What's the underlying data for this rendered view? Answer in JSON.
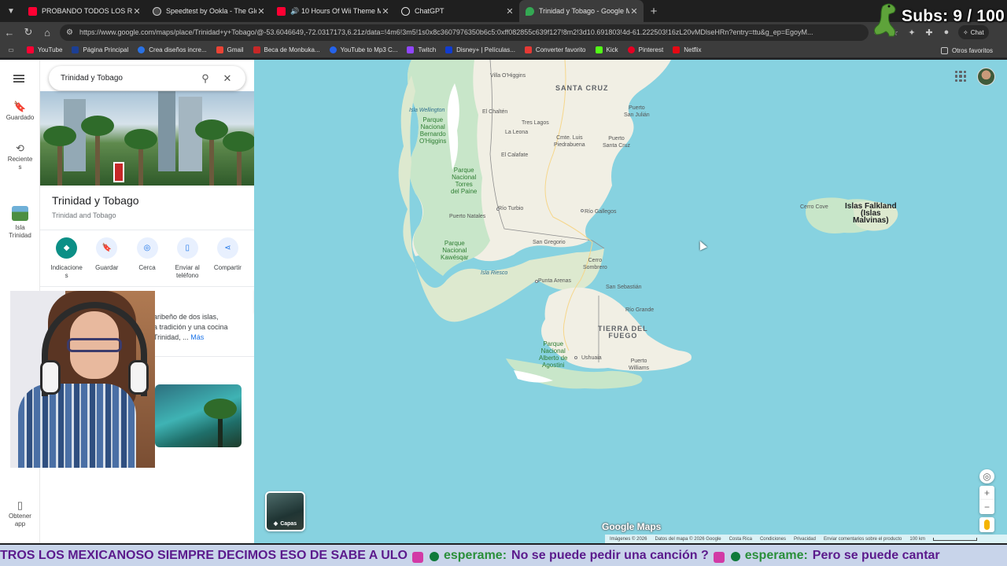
{
  "browser": {
    "tabs": [
      {
        "title": "PROBANDO TODOS LOS RAMEN",
        "favicon_color": "#ff0033"
      },
      {
        "title": "Speedtest by Ookla - The Global B",
        "favicon_color": "#e3e3e3"
      },
      {
        "title": "10 Hours Of Wii Theme Music",
        "favicon_color": "#ff0033"
      },
      {
        "title": "ChatGPT",
        "favicon_color": "#e3e3e3"
      },
      {
        "title": "Trinidad y Tobago - Google Maps",
        "favicon_color": "#34a853",
        "active": true
      }
    ],
    "new_tab_symbol": "+",
    "url": "https://www.google.com/maps/place/Trinidad+y+Tobago/@-53.6046649,-72.0317173,6.21z/data=!4m6!3m5!1s0x8c3607976350b6c5:0xff082855c639f127!8m2!3d10.691803!4d-61.222503!16zL20vMDlseHRn?entry=ttu&g_ep=EgoyM...",
    "chat_label": "Chat"
  },
  "overlay": {
    "subs_text": "Subs: 9 / 100"
  },
  "bookmarks": [
    {
      "label": "YouTube",
      "color": "#ff0033"
    },
    {
      "label": "Página Principal",
      "color": "#1c3f94"
    },
    {
      "label": "Crea diseños incre...",
      "color": "#2a72e5"
    },
    {
      "label": "Gmail",
      "color": "#ea4335"
    },
    {
      "label": "Beca de Monbuka...",
      "color": "#c62828"
    },
    {
      "label": "YouTube to Mp3 C...",
      "color": "#2563eb"
    },
    {
      "label": "Twitch",
      "color": "#9146ff"
    },
    {
      "label": "Disney+ | Películas...",
      "color": "#113ccf"
    },
    {
      "label": "Converter favorito",
      "color": "#e53935"
    },
    {
      "label": "Kick",
      "color": "#53fc18"
    },
    {
      "label": "Pinterest",
      "color": "#e60023"
    },
    {
      "label": "Netflix",
      "color": "#e50914"
    }
  ],
  "other_bookmarks": "Otros favoritos",
  "rail": {
    "saved": "Guardado",
    "recent_line1": "Reciente",
    "recent_line2": "s",
    "isla_line1": "Isla",
    "isla_line2": "Trinidad",
    "app_line1": "Obtener",
    "app_line2": "app"
  },
  "panel": {
    "search_value": "Trinidad y Tobago",
    "title": "Trinidad y Tobago",
    "subtitle": "Trinidad and Tobago",
    "actions": [
      {
        "label_line1": "Indicacione",
        "label_line2": "s",
        "icon": "directions-icon"
      },
      {
        "label_line1": "Guardar",
        "label_line2": "",
        "icon": "bookmark-icon"
      },
      {
        "label_line1": "Cerca",
        "label_line2": "",
        "icon": "nearby-icon"
      },
      {
        "label_line1": "Enviar al",
        "label_line2": "teléfono",
        "icon": "phone-icon"
      },
      {
        "label_line1": "Compartir",
        "label_line2": "",
        "icon": "share-icon"
      }
    ],
    "about_line1": "aribeño de dos islas,",
    "about_line2": "a tradición y una cocina",
    "about_line3": "Trinidad, ...",
    "more": "Más"
  },
  "map": {
    "labels": {
      "santa_cruz": "SANTA CRUZ",
      "villa_ohiggins": "Villa O'Higgins",
      "isla_wellington": "Isla Wellington",
      "parque_bernardo": "Parque\nNacional\nBernardo\nO'Higgins",
      "el_chalten": "El Chaltén",
      "tres_lagos": "Tres Lagos",
      "la_leona": "La Leona",
      "puerto_san_julian": "Puerto\nSan Julián",
      "cmte_piedrabuena": "Cmte. Luis\nPiedrabuena",
      "puerto_santa_cruz": "Puerto\nSanta Cruz",
      "el_calafate": "El Calafate",
      "parque_torres": "Parque\nNacional\nTorres\ndel Paine",
      "rio_turbio": "Río Turbio",
      "rio_gallegos": "Río Gallegos",
      "puerto_natales": "Puerto Natales",
      "san_gregorio": "San Gregorio",
      "parque_kawesqar": "Parque\nNacional\nKawésqar",
      "isla_riesco": "Isla Riesco",
      "cerro_sombrero": "Cerro\nSombrero",
      "punta_arenas": "Punta Arenas",
      "san_sebastian": "San Sebastián",
      "rio_grande": "Río Grande",
      "tierra_fuego": "TIERRA DEL\nFUEGO",
      "parque_agostini": "Parque\nNacional\nAlberto de\nAgostini",
      "ushuaia": "Ushuaia",
      "puerto_williams": "Puerto\nWilliams",
      "cerro_cove": "Cerro Cove",
      "falklands": "Islas Falkland\n(Islas\nMalvinas)"
    },
    "layers_label": "Capas",
    "logo": "Google Maps",
    "attribution": [
      "Imágenes © 2026",
      "Datos del mapa © 2026 Google",
      "Costa Rica",
      "Condiciones",
      "Privacidad",
      "Enviar comentarios sobre el producto",
      "100 km"
    ]
  },
  "ticker": {
    "msg1": "TROS LOS MEXICANOSO SIEMPRE DECIMOS ESO DE SABE A ULO",
    "user1": "esperame:",
    "msg2": "No se puede pedir una canción ?",
    "user2": "esperame:",
    "msg3": "Pero se puede cantar"
  }
}
